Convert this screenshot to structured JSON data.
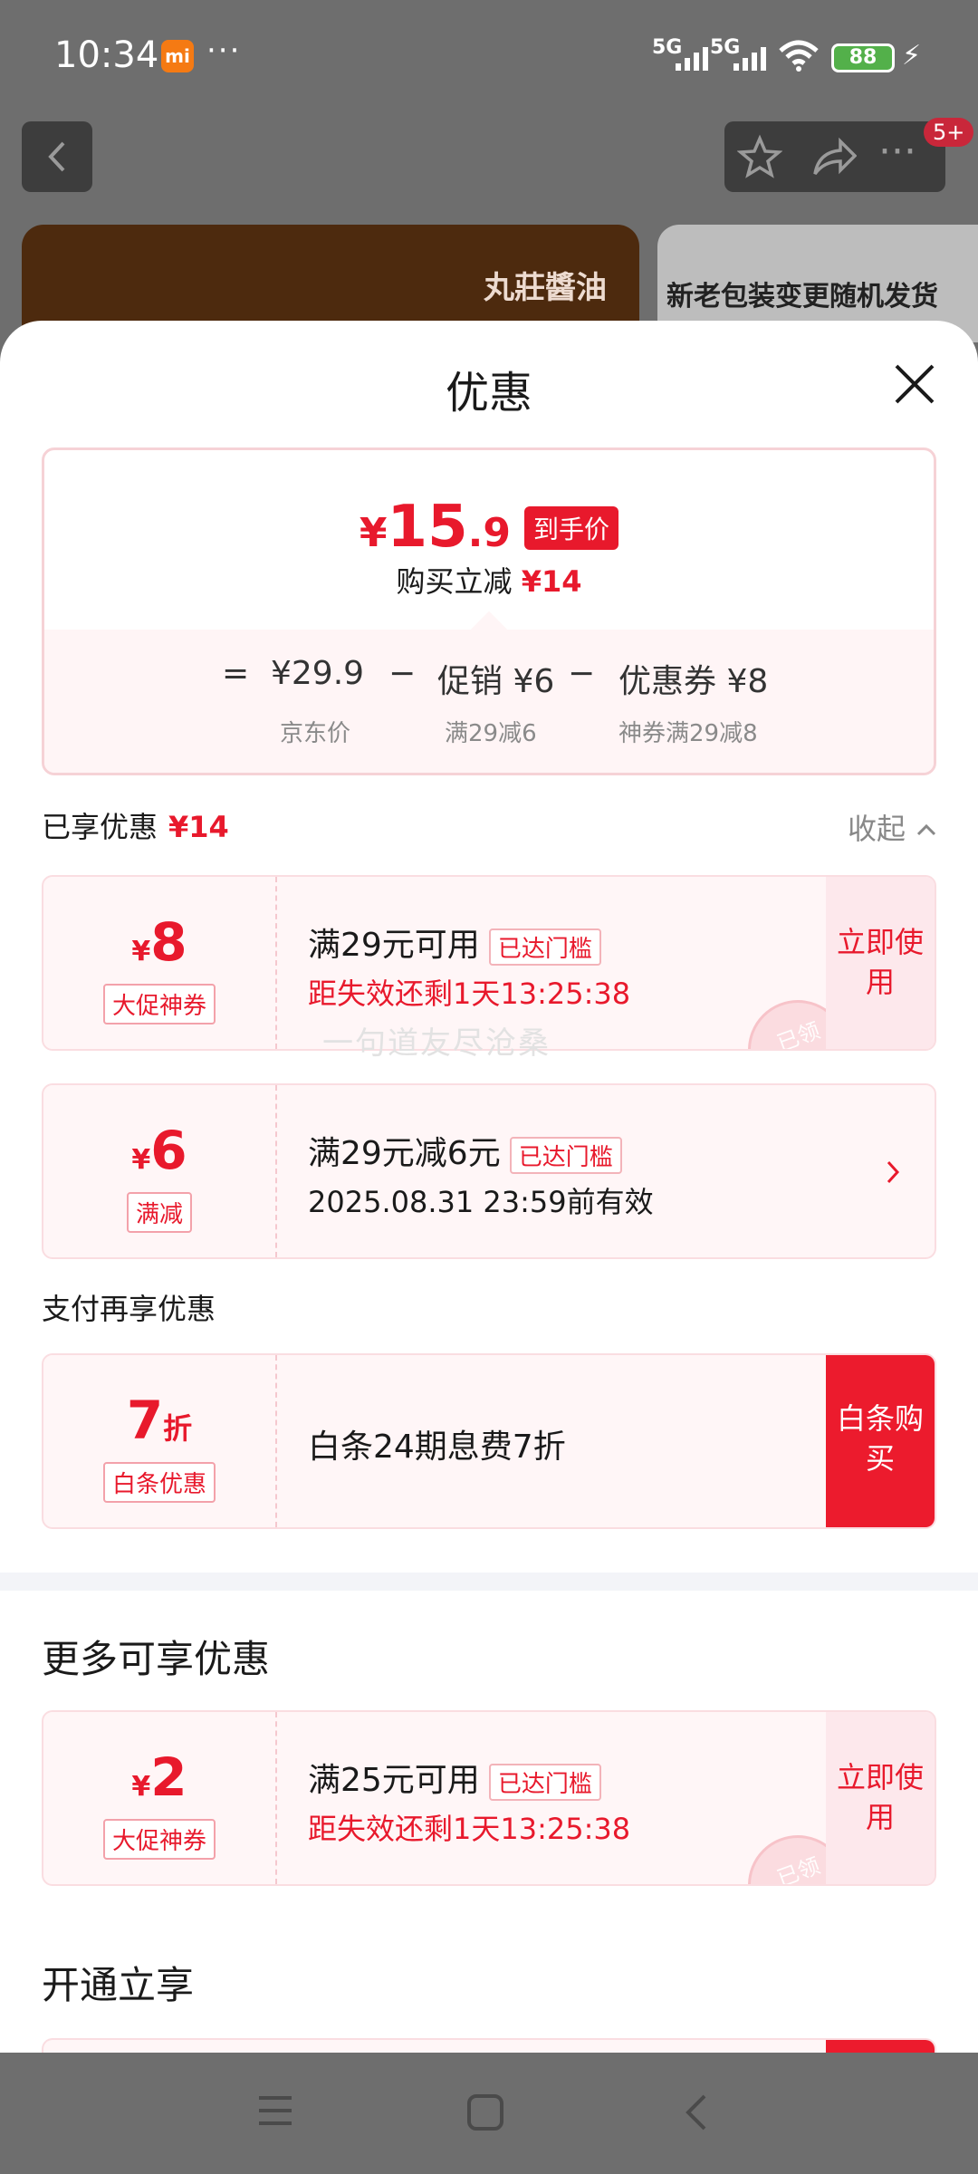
{
  "status_bar": {
    "time": "10:34",
    "dots": "···",
    "net1": "5G",
    "net2": "5G",
    "battery": "88"
  },
  "background": {
    "brand": "丸莊醬油",
    "banner_text": "新老包装变更随机发货",
    "badge": "5+"
  },
  "sheet": {
    "title": "优惠",
    "summary": {
      "currency": "¥",
      "price_int": "15",
      "price_dec": ".9",
      "price_tag": "到手价",
      "sub_text": "购买立减",
      "sub_amount": "¥14",
      "equation": {
        "eq": "=",
        "base": "¥29.9",
        "minus1": "−",
        "promo": "促销 ¥6",
        "minus2": "−",
        "coupon": "优惠券 ¥8",
        "base_caption": "京东价",
        "promo_caption": "满29减6",
        "coupon_caption": "神券满29减8"
      }
    },
    "enjoyed": {
      "label": "已享优惠",
      "amount": "¥14",
      "collapse": "收起"
    },
    "coupons": [
      {
        "sym": "¥",
        "amount": "8",
        "tag": "大促神券",
        "title": "满29元可用",
        "badge": "已达门槛",
        "line2": "距失效还剩1天13:25:38",
        "action": "立即使用",
        "stamp": "已领"
      },
      {
        "sym": "¥",
        "amount": "6",
        "tag": "满减",
        "title": "满29元减6元",
        "badge": "已达门槛",
        "line2": "2025.08.31 23:59前有效"
      }
    ],
    "pay_section": {
      "label": "支付再享优惠"
    },
    "pay_coupon": {
      "amount": "7",
      "unit": "折",
      "tag": "白条优惠",
      "title": "白条24期息费7折",
      "action": "白条购买"
    },
    "more_section": {
      "label": "更多可享优惠"
    },
    "more_coupon": {
      "sym": "¥",
      "amount": "2",
      "tag": "大促神券",
      "title": "满25元可用",
      "badge": "已达门槛",
      "line2": "距失效还剩1天13:25:38",
      "action": "立即使用",
      "stamp": "已领"
    },
    "open_section": {
      "label": "开通立享"
    },
    "watermark": "一句道友尽沧桑"
  },
  "colors": {
    "accent": "#e8192c",
    "coupon_bg": "#fff6f7"
  }
}
